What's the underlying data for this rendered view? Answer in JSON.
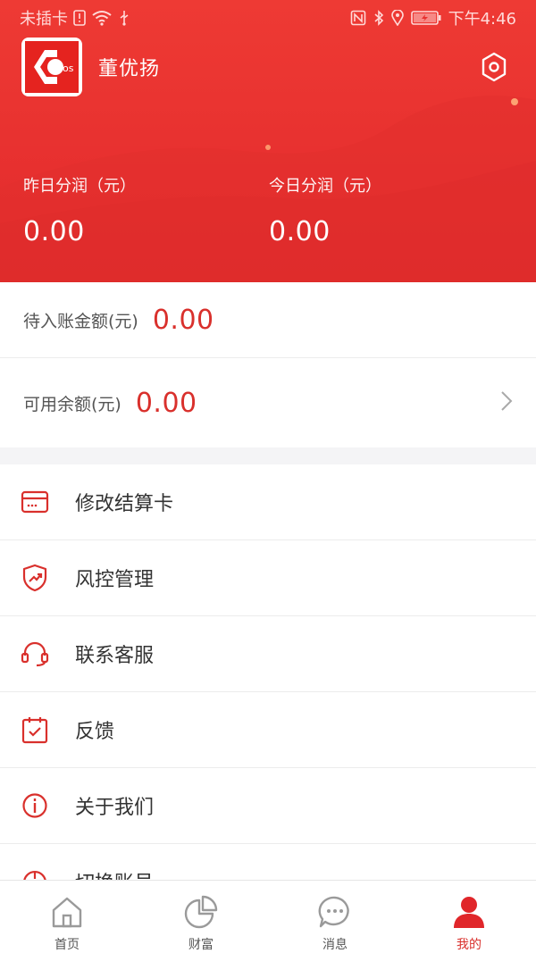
{
  "status_bar": {
    "carrier": "未插卡",
    "time": "下午4:46"
  },
  "profile": {
    "logo_text": "os",
    "name": "董优扬"
  },
  "stats": {
    "yesterday": {
      "label": "昨日分润（元）",
      "value": "0.00"
    },
    "today": {
      "label": "今日分润（元）",
      "value": "0.00"
    }
  },
  "balances": {
    "pending": {
      "label": "待入账金额(元)",
      "value": "0.00"
    },
    "available": {
      "label": "可用余额(元)",
      "value": "0.00"
    }
  },
  "menu": [
    {
      "label": "修改结算卡",
      "icon": "card-icon"
    },
    {
      "label": "风控管理",
      "icon": "shield-trend-icon"
    },
    {
      "label": "联系客服",
      "icon": "headset-icon"
    },
    {
      "label": "反馈",
      "icon": "calendar-check-icon"
    },
    {
      "label": "关于我们",
      "icon": "info-icon"
    },
    {
      "label": "切换账号",
      "icon": "switch-account-icon"
    }
  ],
  "tabs": [
    {
      "label": "首页",
      "icon": "home-icon"
    },
    {
      "label": "财富",
      "icon": "pie-chart-icon"
    },
    {
      "label": "消息",
      "icon": "chat-icon"
    },
    {
      "label": "我的",
      "icon": "user-icon"
    }
  ],
  "colors": {
    "brand_red": "#e7302f",
    "value_red": "#d9302c",
    "inactive_gray": "#9a9a9a"
  }
}
